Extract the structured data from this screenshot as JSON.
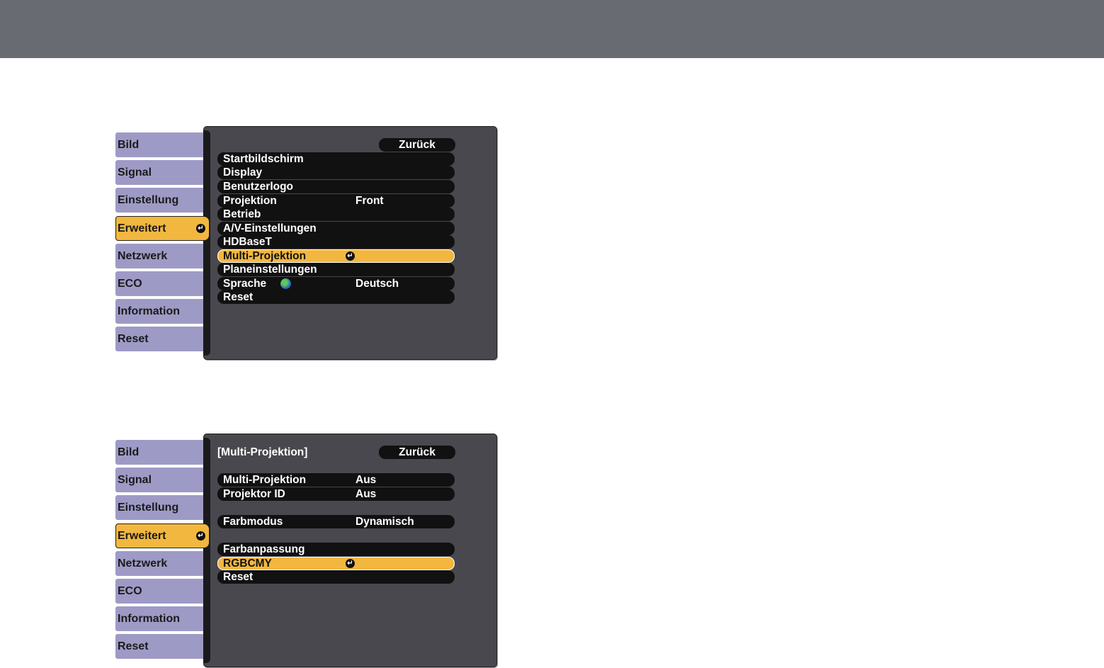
{
  "colors": {
    "tab": "#9e9ac6",
    "highlight": "#f2b73f",
    "row": "#111111",
    "panel": "#48484e",
    "topbar": "#696b73"
  },
  "tabs": [
    "Bild",
    "Signal",
    "Einstellung",
    "Erweitert",
    "Netzwerk",
    "ECO",
    "Information",
    "Reset"
  ],
  "active_tab": "Erweitert",
  "screen1": {
    "title": "",
    "back_label": "Zurück",
    "rows": [
      {
        "label": "Startbildschirm",
        "value": ""
      },
      {
        "label": "Display",
        "value": ""
      },
      {
        "label": "Benutzerlogo",
        "value": ""
      },
      {
        "label": "Projektion",
        "value": "Front"
      },
      {
        "label": "Betrieb",
        "value": ""
      },
      {
        "label": "A/V-Einstellungen",
        "value": ""
      },
      {
        "label": "HDBaseT",
        "value": ""
      },
      {
        "label": "Multi-Projektion",
        "value": "",
        "selected": true
      },
      {
        "label": "Planeinstellungen",
        "value": ""
      },
      {
        "label": "Sprache",
        "value": "Deutsch",
        "icon": "globe-icon"
      },
      {
        "label": "Reset",
        "value": ""
      }
    ]
  },
  "screen2": {
    "title": "[Multi-Projektion]",
    "back_label": "Zurück",
    "rows": [
      {
        "label": "Multi-Projektion",
        "value": "Aus"
      },
      {
        "label": "Projektor ID",
        "value": "Aus"
      },
      {
        "label": "Farbmodus",
        "value": "Dynamisch"
      },
      {
        "label": "Farbanpassung",
        "value": ""
      },
      {
        "label": "RGBCMY",
        "value": "",
        "selected": true
      },
      {
        "label": "Reset",
        "value": ""
      }
    ]
  }
}
